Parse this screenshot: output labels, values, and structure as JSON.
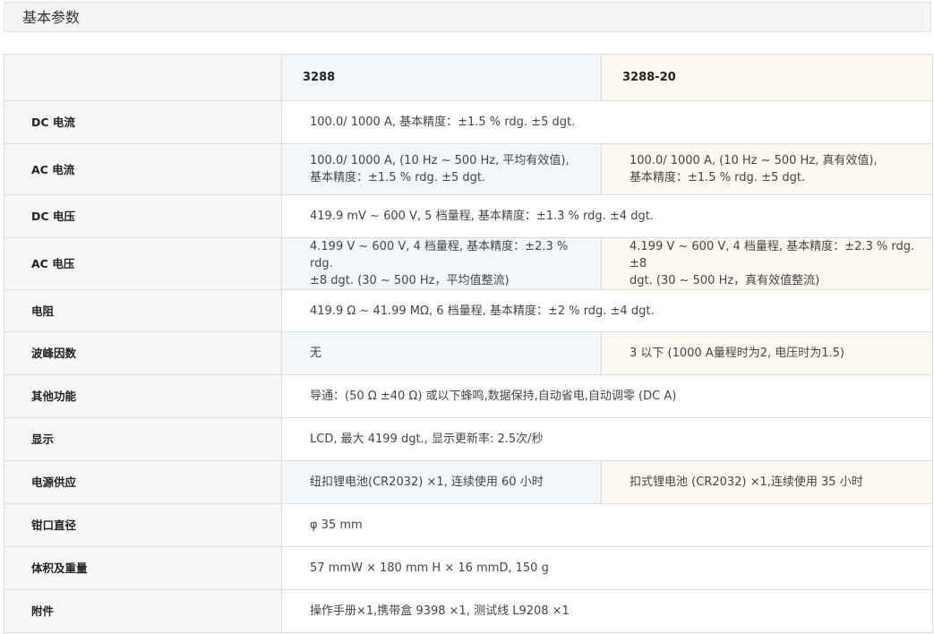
{
  "section": {
    "title": "基本参数"
  },
  "table": {
    "models": [
      "3288",
      "3288-20"
    ],
    "rows": [
      {
        "label": "DC 电流",
        "shared": "100.0/ 1000 A, 基本精度：±1.5 % rdg. ±5 dgt."
      },
      {
        "label": "AC 电流",
        "a": [
          "100.0/ 1000 A, (10 Hz ~ 500 Hz, 平均有效值),",
          "基本精度：±1.5 % rdg. ±5 dgt."
        ],
        "b": [
          "100.0/ 1000 A, (10 Hz ~ 500 Hz, 真有效值),",
          "基本精度：±1.5 % rdg. ±5 dgt."
        ]
      },
      {
        "label": "DC 电压",
        "shared": "419.9 mV ~ 600 V, 5 档量程, 基本精度：±1.3 % rdg. ±4 dgt."
      },
      {
        "label": "AC 电压",
        "a": [
          "4.199 V ~ 600 V, 4 档量程, 基本精度：±2.3 % rdg.",
          "±8 dgt. (30 ~ 500 Hz，平均值整流)"
        ],
        "b": [
          "4.199 V ~ 600 V, 4 档量程, 基本精度：±2.3 % rdg. ±8",
          "dgt. (30 ~ 500 Hz，真有效值整流)"
        ]
      },
      {
        "label": "电阻",
        "shared": "419.9 Ω ~ 41.99 MΩ, 6 档量程, 基本精度：±2 % rdg. ±4 dgt."
      },
      {
        "label": "波峰因数",
        "a": [
          "无"
        ],
        "b": [
          "3 以下 (1000 A量程时为2, 电压时为1.5)"
        ]
      },
      {
        "label": "其他功能",
        "shared": "导通：(50 Ω ±40 Ω) 或以下蜂鸣,数据保持,自动省电,自动调零 (DC A)"
      },
      {
        "label": "显示",
        "shared": "LCD, 最大 4199 dgt., 显示更新率: 2.5次/秒"
      },
      {
        "label": "电源供应",
        "a": [
          "纽扣锂电池(CR2032) ×1, 连续使用 60 小时"
        ],
        "b": [
          "扣式锂电池 (CR2032) ×1,连续使用 35 小时"
        ]
      },
      {
        "label": "钳口直径",
        "shared": "φ 35 mm"
      },
      {
        "label": "体积及重量",
        "shared": "57 mmW × 180 mm H × 16 mmD, 150 g"
      },
      {
        "label": "附件",
        "shared": "操作手册×1,携带盒 9398 ×1, 测试线 L9208 ×1"
      }
    ]
  }
}
